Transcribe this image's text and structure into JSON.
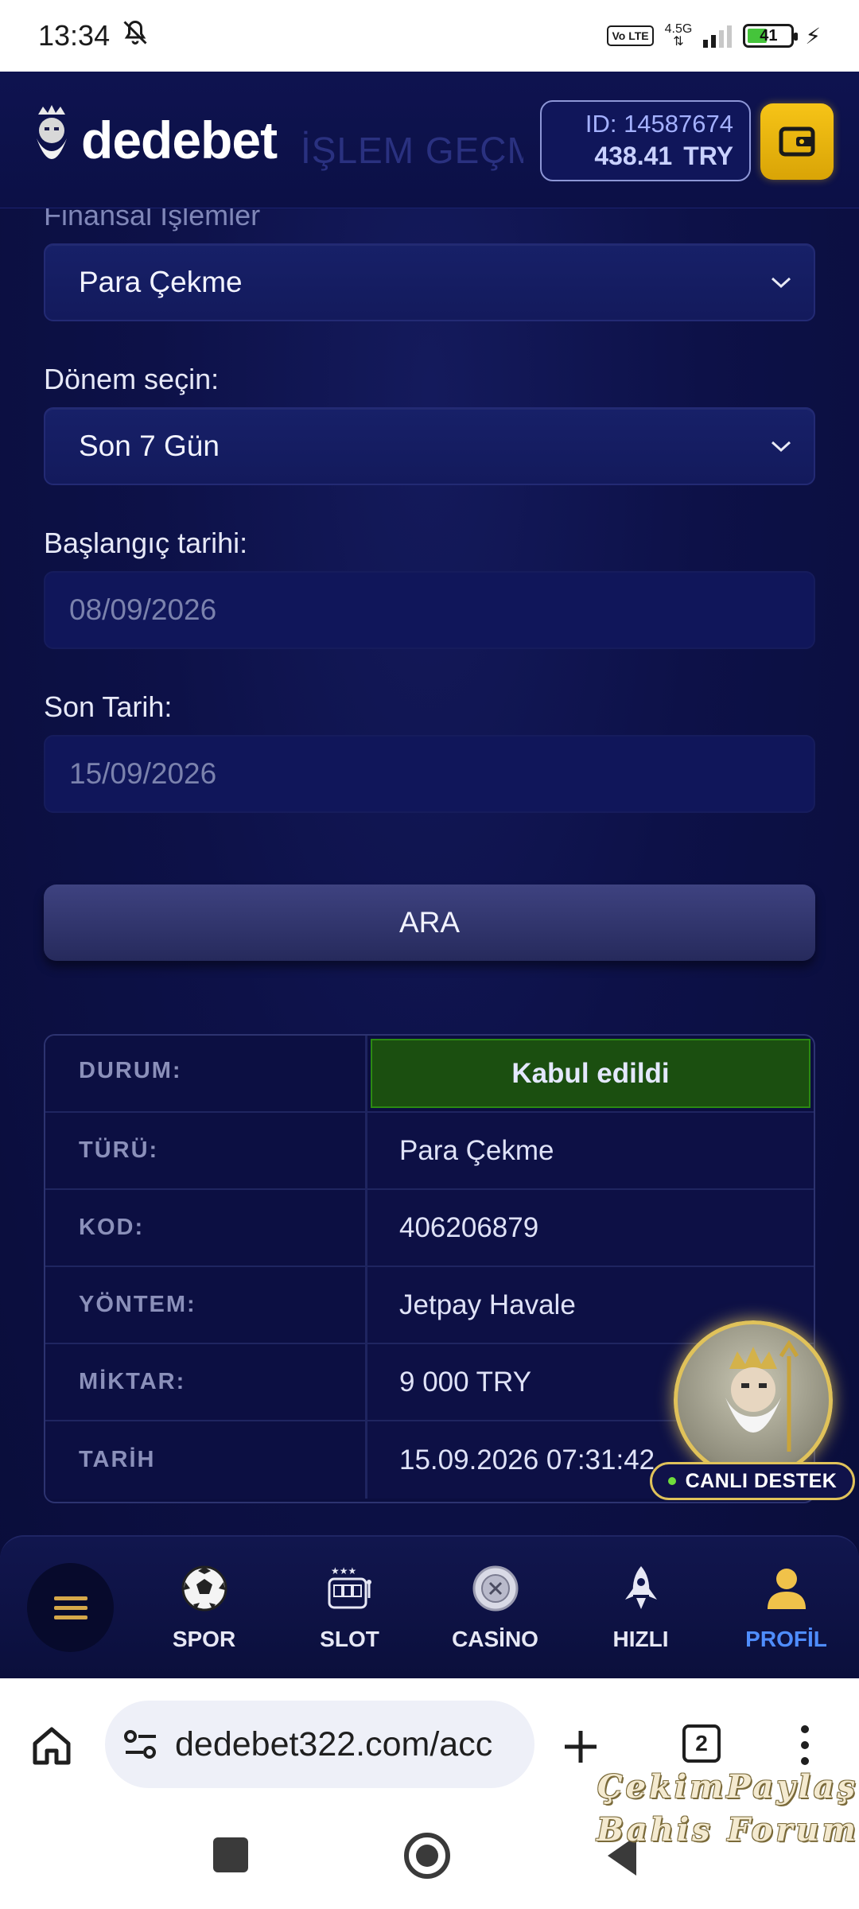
{
  "status_bar": {
    "time": "13:34",
    "network": "4.5G",
    "volte": "Vo LTE",
    "battery": "41"
  },
  "header": {
    "logo_text": "dedebet",
    "ghost_title": "İŞLEM GEÇMİŞİ",
    "account_id": "ID: 14587674",
    "balance": "438.41",
    "currency": "TRY"
  },
  "form": {
    "transaction_type_label": "Finansal İşlemler",
    "transaction_type_value": "Para Çekme",
    "period_label": "Dönem seçin:",
    "period_value": "Son 7 Gün",
    "start_date_label": "Başlangıç tarihi:",
    "start_date_value": "08/09/2026",
    "end_date_label": "Son Tarih:",
    "end_date_value": "15/09/2026",
    "search_button": "ARA"
  },
  "result": {
    "rows": [
      {
        "key": "DURUM:",
        "value": "Kabul edildi"
      },
      {
        "key": "TÜRÜ:",
        "value": "Para Çekme"
      },
      {
        "key": "KOD:",
        "value": "406206879"
      },
      {
        "key": "YÖNTEM:",
        "value": "Jetpay Havale"
      },
      {
        "key": "MİKTAR:",
        "value": "9 000 TRY"
      },
      {
        "key": "TARİH",
        "value": "15.09.2026 07:31:42"
      }
    ]
  },
  "support": {
    "label": "CANLI DESTEK"
  },
  "bottom_nav": {
    "items": [
      {
        "label": "SPOR",
        "icon": "soccer-ball-icon"
      },
      {
        "label": "SLOT",
        "icon": "slot-machine-icon"
      },
      {
        "label": "CASİNO",
        "icon": "casino-chip-icon"
      },
      {
        "label": "HIZLI",
        "icon": "rocket-icon"
      },
      {
        "label": "PROFİL",
        "icon": "user-icon",
        "active": true
      }
    ]
  },
  "browser": {
    "url": "dedebet322.com/acc",
    "tab_count": "2"
  },
  "watermark": {
    "line1": "ÇekimPaylaş",
    "line2": "Bahis Forum"
  },
  "colors": {
    "page_bg": "#0b0e3a",
    "accent_gold": "#f6c417",
    "status_success": "#1b4f10",
    "nav_active": "#4f8dff"
  }
}
